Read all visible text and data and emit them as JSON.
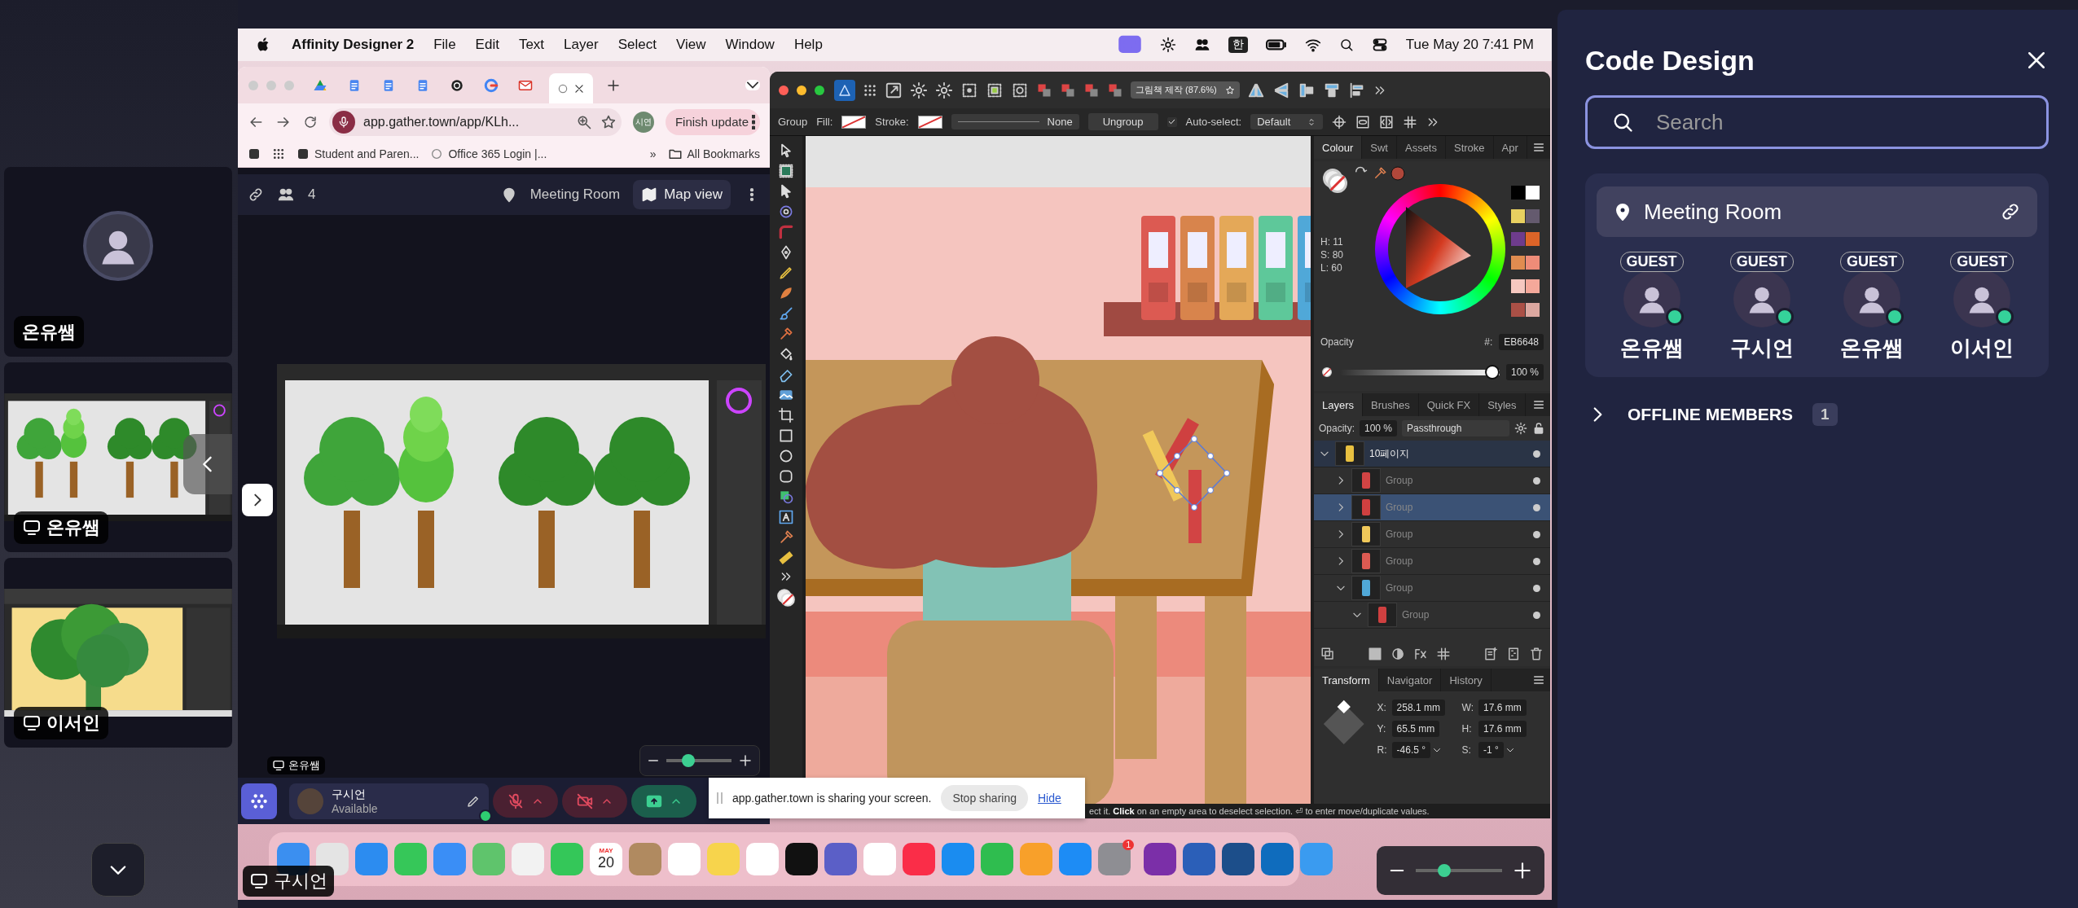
{
  "tiles": [
    {
      "kind": "avatar",
      "name": "온유쌤"
    },
    {
      "kind": "screen",
      "name": "온유쌤"
    },
    {
      "kind": "screen",
      "name": "이서인"
    }
  ],
  "screen": {
    "menu_bar": {
      "app": "Affinity Designer 2",
      "menus": [
        "File",
        "Edit",
        "Text",
        "Layer",
        "Select",
        "View",
        "Window",
        "Help"
      ],
      "input_source": "한",
      "clock": "Tue May 20  7:41 PM"
    },
    "browser": {
      "tabs": [
        {
          "selected": false
        },
        {
          "selected": false
        },
        {
          "selected": false
        },
        {
          "selected": false
        },
        {
          "selected": false
        },
        {
          "selected": false
        },
        {
          "selected": false
        },
        {
          "selected": true
        }
      ],
      "url": "app.gather.town/app/KLh...",
      "profile": "시연",
      "update_button": "Finish update",
      "bookmarks": [
        "Student and Paren...",
        "Office 365 Login |..."
      ],
      "overflow": "»",
      "all_bookmarks": "All Bookmarks"
    },
    "gather": {
      "participants": "4",
      "room": "Meeting Room",
      "map_button": "Map view",
      "stream_label": "온유쌤",
      "stage_zoom": {
        "level": 0.3
      },
      "user": {
        "name": "구시언",
        "status": "Available"
      },
      "microphone": {
        "on": false
      },
      "camera": {
        "on": false
      },
      "screen_share": {
        "on": true
      }
    },
    "share_notice": {
      "message": "app.gather.town is sharing your screen.",
      "stop_button": "Stop sharing",
      "hide_link": "Hide"
    },
    "designer": {
      "document": "그림책 제작 (87.6%)",
      "context_bar": {
        "object": "Group",
        "fill_label": "Fill:",
        "stroke_label": "Stroke:",
        "stroke_style": "None",
        "ungroup_button": "Ungroup",
        "auto_select": {
          "label": "Auto-select:",
          "checked": true
        },
        "auto_select_mode": "Default"
      },
      "colour_panel": {
        "tabs": [
          {
            "label": "Colour",
            "selected": true
          },
          {
            "label": "Swt",
            "selected": false
          },
          {
            "label": "Assets",
            "selected": false
          },
          {
            "label": "Stroke",
            "selected": false
          },
          {
            "label": "Apr",
            "selected": false
          }
        ],
        "hsl": [
          "H: 11",
          "S: 80",
          "L: 60"
        ],
        "opacity_label": "Opacity",
        "opacity_slider": {
          "level": 1
        },
        "opacity": "100 %",
        "hex_label": "#:",
        "hex": "EB6648",
        "swatches": [
          {
            "color": "#000000"
          },
          {
            "color": "#ffffff"
          },
          {
            "color": "#e8d060"
          },
          {
            "color": "#645a6e"
          },
          {
            "color": "#6e3c8c"
          },
          {
            "color": "#dc6428"
          },
          {
            "color": "#e08c50"
          },
          {
            "color": "#ee8c78"
          },
          {
            "color": "#f6c8c0"
          },
          {
            "color": "#f4a89a"
          },
          {
            "color": "#aa5046"
          },
          {
            "color": "#dca8a0"
          }
        ]
      },
      "layers_panel": {
        "tabs": [
          {
            "label": "Layers",
            "selected": true
          },
          {
            "label": "Brushes",
            "selected": false
          },
          {
            "label": "Quick FX",
            "selected": false
          },
          {
            "label": "Styles",
            "selected": false
          }
        ],
        "opacity_label": "Opacity:",
        "opacity": "100 %",
        "blend_mode": "Passthrough",
        "layers": [
          {
            "name": "10페이지",
            "selected": false,
            "expanded": true,
            "children": [
              {
                "name": "Group",
                "selected": false,
                "expanded": false
              },
              {
                "name": "Group",
                "selected": true,
                "expanded": false
              },
              {
                "name": "Group",
                "selected": false,
                "expanded": false
              },
              {
                "name": "Group",
                "selected": false,
                "expanded": false
              },
              {
                "name": "Group",
                "selected": false,
                "expanded": true,
                "children": [
                  {
                    "name": "Group",
                    "selected": false,
                    "expanded": true
                  }
                ]
              }
            ]
          }
        ]
      },
      "transform_panel": {
        "tabs": [
          {
            "label": "Transform",
            "selected": true
          },
          {
            "label": "Navigator",
            "selected": false
          },
          {
            "label": "History",
            "selected": false
          }
        ],
        "fields": [
          {
            "label": "X:",
            "value": "258.1 mm",
            "kind": "number"
          },
          {
            "label": "W:",
            "value": "17.6 mm",
            "kind": "number"
          },
          {
            "label": "Y:",
            "value": "65.5 mm",
            "kind": "number"
          },
          {
            "label": "H:",
            "value": "17.6 mm",
            "kind": "number"
          },
          {
            "label": "R:",
            "value": "-46.5 °",
            "kind": "dropdown"
          },
          {
            "label": "S:",
            "value": "-1 °",
            "kind": "dropdown"
          }
        ]
      },
      "status_text": "ect it. **Click** on an empty area to deselect selection. ⏎ to enter move/duplicate values."
    },
    "dock": {
      "calendar_month": "MAY",
      "calendar_day": "20",
      "settings_badge": "1"
    },
    "presenter_label": "구시언",
    "view_zoom": {
      "level": 0.3
    }
  },
  "panel": {
    "title": "Code Design",
    "search_placeholder": "Search",
    "room": {
      "name": "Meeting Room",
      "members": [
        {
          "role": "GUEST",
          "name": "온유쌤",
          "online": true
        },
        {
          "role": "GUEST",
          "name": "구시언",
          "online": true
        },
        {
          "role": "GUEST",
          "name": "온유쌤",
          "online": true
        },
        {
          "role": "GUEST",
          "name": "이서인",
          "online": true
        }
      ]
    },
    "offline": {
      "label": "OFFLINE MEMBERS",
      "count": "1",
      "expanded": false
    }
  }
}
